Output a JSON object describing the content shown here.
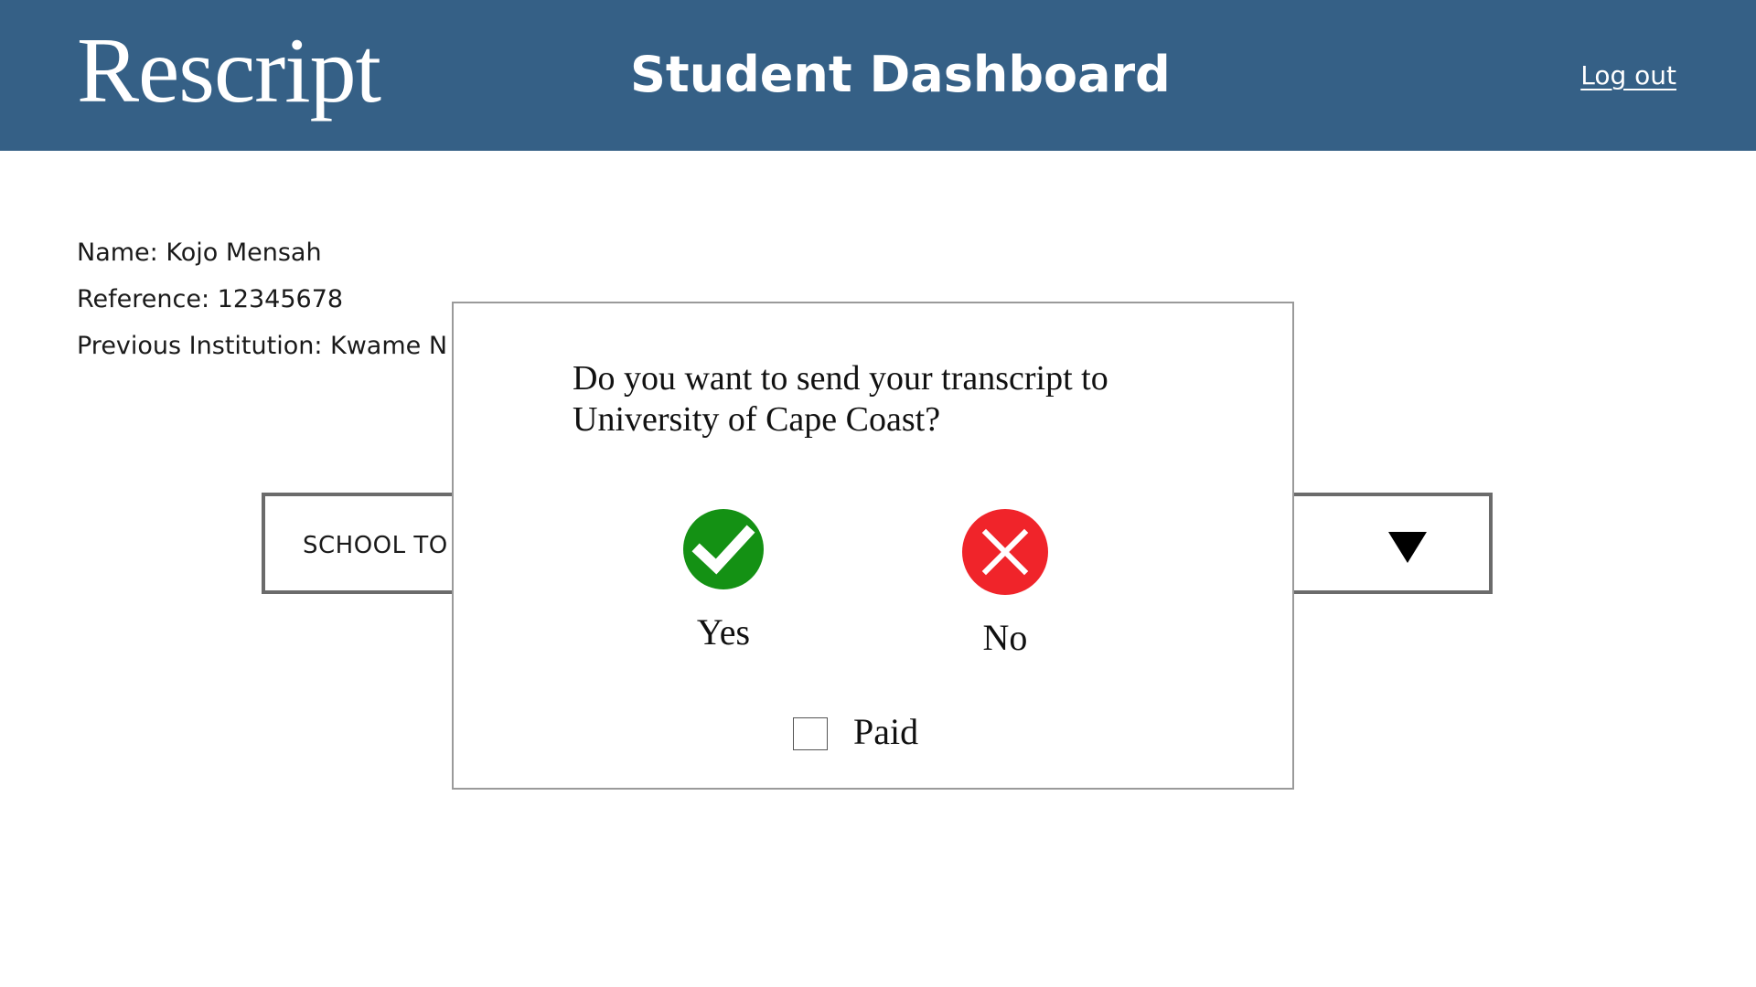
{
  "header": {
    "logo_text": "Rescript",
    "title": "Student Dashboard",
    "logout_label": "Log out",
    "background_color": "#356086"
  },
  "student": {
    "name_line": "Name: Kojo Mensah",
    "reference_line": "Reference: 12345678",
    "institution_line": "Previous Institution: Kwame N"
  },
  "dropdown": {
    "visible_text": "SCHOOL TO",
    "arrow_icon": "triangle-down-icon"
  },
  "modal": {
    "question": "Do you want to send your transcript to University of Cape Coast?",
    "yes_label": "Yes",
    "no_label": "No",
    "paid_label": "Paid",
    "paid_checked": false,
    "yes_icon": "checkmark-circle-icon",
    "no_icon": "x-circle-icon",
    "yes_color": "#149114",
    "no_color": "#f0242a"
  }
}
